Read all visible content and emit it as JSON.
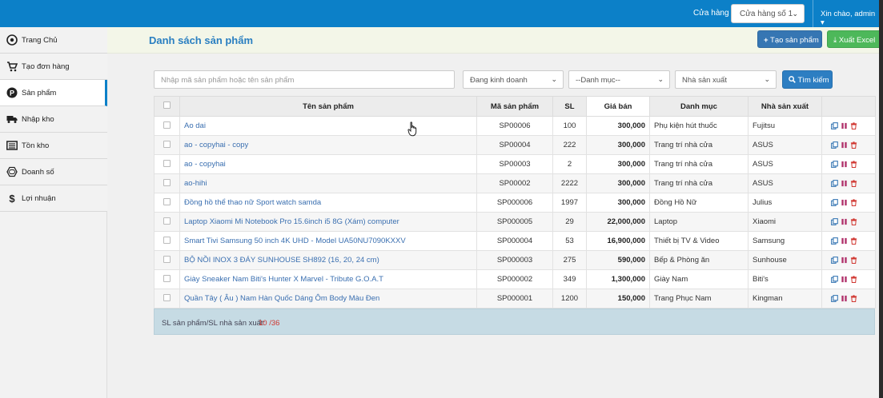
{
  "topbar": {
    "store_label": "Cửa hàng",
    "store_value": "Cửa hàng số 1",
    "greeting": "Xin chào, admin"
  },
  "sidebar": {
    "items": [
      {
        "label": "Trang Chủ",
        "icon": "eye-icon",
        "active": false
      },
      {
        "label": "Tạo đơn hàng",
        "icon": "cart-icon",
        "active": false
      },
      {
        "label": "Sản phẩm",
        "icon": "product-p-icon",
        "active": true
      },
      {
        "label": "Nhập kho",
        "icon": "truck-icon",
        "active": false
      },
      {
        "label": "Tồn kho",
        "icon": "list-box-icon",
        "active": false
      },
      {
        "label": "Doanh số",
        "icon": "hexagon-icon",
        "active": false
      },
      {
        "label": "Lợi nhuận",
        "icon": "dollar-icon",
        "active": false
      }
    ]
  },
  "main": {
    "title": "Danh sách sản phẩm",
    "create_label": "Tạo sản phẩm",
    "excel_label": "Xuất Excel"
  },
  "filters": {
    "search_placeholder": "Nhập mã sản phẩm hoặc tên sản phẩm",
    "status": "Đang kinh doanh",
    "category": "--Danh mục--",
    "maker": "Nhà sản xuất",
    "search_button": "Tìm kiếm"
  },
  "table": {
    "headers": {
      "name": "Tên sản phẩm",
      "code": "Mã sản phẩm",
      "qty": "SL",
      "price": "Giá bán",
      "category": "Danh mục",
      "maker": "Nhà sản xuất"
    },
    "rows": [
      {
        "name": "Ao dai",
        "code": "SP00006",
        "qty": "100",
        "price": "300,000",
        "category": "Phụ kiện hút thuốc",
        "maker": "Fujitsu"
      },
      {
        "name": "ao - copyhai - copy",
        "code": "SP00004",
        "qty": "222",
        "price": "300,000",
        "category": "Trang trí nhà cửa",
        "maker": "ASUS"
      },
      {
        "name": "ao - copyhai",
        "code": "SP00003",
        "qty": "2",
        "price": "300,000",
        "category": "Trang trí nhà cửa",
        "maker": "ASUS"
      },
      {
        "name": "ao-hihi",
        "code": "SP00002",
        "qty": "2222",
        "price": "300,000",
        "category": "Trang trí nhà cửa",
        "maker": "ASUS"
      },
      {
        "name": "Đồng hồ thể thao nữ Sport watch samda",
        "code": "SP000006",
        "qty": "1997",
        "price": "300,000",
        "category": "Đồng Hồ Nữ",
        "maker": "Julius"
      },
      {
        "name": "Laptop Xiaomi Mi Notebook Pro 15.6inch i5 8G (Xám) computer",
        "code": "SP000005",
        "qty": "29",
        "price": "22,000,000",
        "category": "Laptop",
        "maker": "Xiaomi"
      },
      {
        "name": "Smart Tivi Samsung 50 inch 4K UHD - Model UA50NU7090KXXV",
        "code": "SP000004",
        "qty": "53",
        "price": "16,900,000",
        "category": "Thiết bị TV & Video",
        "maker": "Samsung"
      },
      {
        "name": "BỘ NỒI INOX 3 ĐÁY SUNHOUSE SH892 (16, 20, 24 cm)",
        "code": "SP000003",
        "qty": "275",
        "price": "590,000",
        "category": "Bếp & Phòng ăn",
        "maker": "Sunhouse"
      },
      {
        "name": "Giày Sneaker Nam Biti's Hunter X Marvel - Tribute G.O.A.T",
        "code": "SP000002",
        "qty": "349",
        "price": "1,300,000",
        "category": "Giày Nam",
        "maker": "Biti's"
      },
      {
        "name": "Quần Tây ( Âu ) Nam Hàn Quốc Dáng Ôm Body Màu Đen",
        "code": "SP000001",
        "qty": "1200",
        "price": "150,000",
        "category": "Trang Phục Nam",
        "maker": "Kingman"
      }
    ]
  },
  "footer": {
    "label": "SL sản phẩm/SL nhà sản xuất:",
    "counts": "10 /36"
  },
  "colors": {
    "primary": "#0c80c8",
    "success": "#4db85a",
    "danger": "#d0352f",
    "pause": "#b0306a"
  }
}
